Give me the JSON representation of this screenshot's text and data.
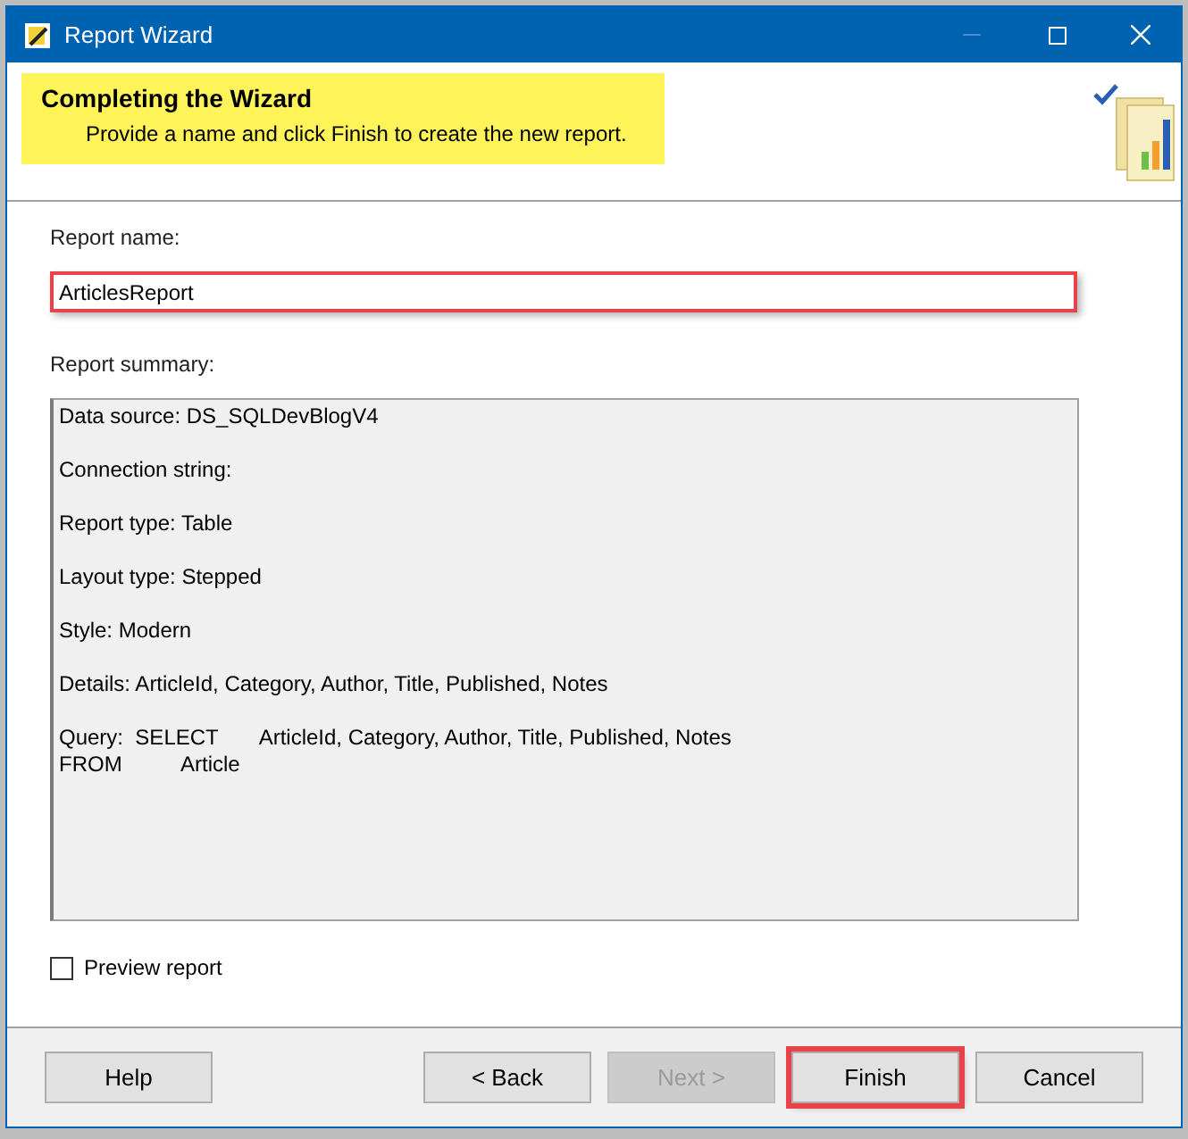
{
  "window": {
    "title": "Report Wizard"
  },
  "header": {
    "title": "Completing the Wizard",
    "subtitle": "Provide a name and click Finish to create the new report."
  },
  "report_name": {
    "label": "Report name:",
    "value": "ArticlesReport",
    "highlighted": true
  },
  "summary": {
    "label": "Report summary:",
    "lines": [
      {
        "kind": "paragraph",
        "text": "Data source: DS_SQLDevBlogV4"
      },
      {
        "kind": "paragraph",
        "text": "Connection string:"
      },
      {
        "kind": "paragraph",
        "text": "Report type: Table"
      },
      {
        "kind": "paragraph",
        "text": "Layout type: Stepped"
      },
      {
        "kind": "paragraph",
        "text": "Style: Modern"
      },
      {
        "kind": "paragraph",
        "text": "Details: ArticleId, Category, Author, Title, Published, Notes"
      },
      {
        "kind": "paragraph",
        "text": "Query:  SELECT       ArticleId, Category, Author, Title, Published, Notes"
      },
      {
        "kind": "continuation",
        "text": "FROM          Article"
      }
    ]
  },
  "preview": {
    "label": "Preview report",
    "checked": false
  },
  "help_button": {
    "label": "Help",
    "disabled": false,
    "highlighted": false
  },
  "buttons": [
    {
      "label": "< Back",
      "disabled": false,
      "highlighted": false
    },
    {
      "label": "Next >",
      "disabled": true,
      "highlighted": false
    },
    {
      "label": "Finish",
      "disabled": false,
      "highlighted": true
    },
    {
      "label": "Cancel",
      "disabled": false,
      "highlighted": false
    }
  ]
}
